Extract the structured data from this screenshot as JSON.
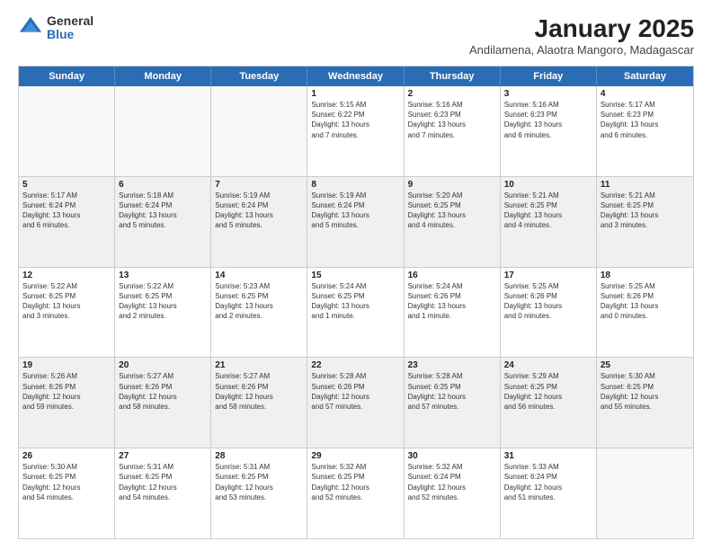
{
  "header": {
    "logo_general": "General",
    "logo_blue": "Blue",
    "title": "January 2025",
    "subtitle": "Andilamena, Alaotra Mangoro, Madagascar"
  },
  "days_of_week": [
    "Sunday",
    "Monday",
    "Tuesday",
    "Wednesday",
    "Thursday",
    "Friday",
    "Saturday"
  ],
  "weeks": [
    [
      {
        "num": "",
        "info": ""
      },
      {
        "num": "",
        "info": ""
      },
      {
        "num": "",
        "info": ""
      },
      {
        "num": "1",
        "info": "Sunrise: 5:15 AM\nSunset: 6:22 PM\nDaylight: 13 hours\nand 7 minutes."
      },
      {
        "num": "2",
        "info": "Sunrise: 5:16 AM\nSunset: 6:23 PM\nDaylight: 13 hours\nand 7 minutes."
      },
      {
        "num": "3",
        "info": "Sunrise: 5:16 AM\nSunset: 6:23 PM\nDaylight: 13 hours\nand 6 minutes."
      },
      {
        "num": "4",
        "info": "Sunrise: 5:17 AM\nSunset: 6:23 PM\nDaylight: 13 hours\nand 6 minutes."
      }
    ],
    [
      {
        "num": "5",
        "info": "Sunrise: 5:17 AM\nSunset: 6:24 PM\nDaylight: 13 hours\nand 6 minutes."
      },
      {
        "num": "6",
        "info": "Sunrise: 5:18 AM\nSunset: 6:24 PM\nDaylight: 13 hours\nand 5 minutes."
      },
      {
        "num": "7",
        "info": "Sunrise: 5:19 AM\nSunset: 6:24 PM\nDaylight: 13 hours\nand 5 minutes."
      },
      {
        "num": "8",
        "info": "Sunrise: 5:19 AM\nSunset: 6:24 PM\nDaylight: 13 hours\nand 5 minutes."
      },
      {
        "num": "9",
        "info": "Sunrise: 5:20 AM\nSunset: 6:25 PM\nDaylight: 13 hours\nand 4 minutes."
      },
      {
        "num": "10",
        "info": "Sunrise: 5:21 AM\nSunset: 6:25 PM\nDaylight: 13 hours\nand 4 minutes."
      },
      {
        "num": "11",
        "info": "Sunrise: 5:21 AM\nSunset: 6:25 PM\nDaylight: 13 hours\nand 3 minutes."
      }
    ],
    [
      {
        "num": "12",
        "info": "Sunrise: 5:22 AM\nSunset: 6:25 PM\nDaylight: 13 hours\nand 3 minutes."
      },
      {
        "num": "13",
        "info": "Sunrise: 5:22 AM\nSunset: 6:25 PM\nDaylight: 13 hours\nand 2 minutes."
      },
      {
        "num": "14",
        "info": "Sunrise: 5:23 AM\nSunset: 6:25 PM\nDaylight: 13 hours\nand 2 minutes."
      },
      {
        "num": "15",
        "info": "Sunrise: 5:24 AM\nSunset: 6:25 PM\nDaylight: 13 hours\nand 1 minute."
      },
      {
        "num": "16",
        "info": "Sunrise: 5:24 AM\nSunset: 6:26 PM\nDaylight: 13 hours\nand 1 minute."
      },
      {
        "num": "17",
        "info": "Sunrise: 5:25 AM\nSunset: 6:26 PM\nDaylight: 13 hours\nand 0 minutes."
      },
      {
        "num": "18",
        "info": "Sunrise: 5:25 AM\nSunset: 6:26 PM\nDaylight: 13 hours\nand 0 minutes."
      }
    ],
    [
      {
        "num": "19",
        "info": "Sunrise: 5:26 AM\nSunset: 6:26 PM\nDaylight: 12 hours\nand 59 minutes."
      },
      {
        "num": "20",
        "info": "Sunrise: 5:27 AM\nSunset: 6:26 PM\nDaylight: 12 hours\nand 58 minutes."
      },
      {
        "num": "21",
        "info": "Sunrise: 5:27 AM\nSunset: 6:26 PM\nDaylight: 12 hours\nand 58 minutes."
      },
      {
        "num": "22",
        "info": "Sunrise: 5:28 AM\nSunset: 6:26 PM\nDaylight: 12 hours\nand 57 minutes."
      },
      {
        "num": "23",
        "info": "Sunrise: 5:28 AM\nSunset: 6:25 PM\nDaylight: 12 hours\nand 57 minutes."
      },
      {
        "num": "24",
        "info": "Sunrise: 5:29 AM\nSunset: 6:25 PM\nDaylight: 12 hours\nand 56 minutes."
      },
      {
        "num": "25",
        "info": "Sunrise: 5:30 AM\nSunset: 6:25 PM\nDaylight: 12 hours\nand 55 minutes."
      }
    ],
    [
      {
        "num": "26",
        "info": "Sunrise: 5:30 AM\nSunset: 6:25 PM\nDaylight: 12 hours\nand 54 minutes."
      },
      {
        "num": "27",
        "info": "Sunrise: 5:31 AM\nSunset: 6:25 PM\nDaylight: 12 hours\nand 54 minutes."
      },
      {
        "num": "28",
        "info": "Sunrise: 5:31 AM\nSunset: 6:25 PM\nDaylight: 12 hours\nand 53 minutes."
      },
      {
        "num": "29",
        "info": "Sunrise: 5:32 AM\nSunset: 6:25 PM\nDaylight: 12 hours\nand 52 minutes."
      },
      {
        "num": "30",
        "info": "Sunrise: 5:32 AM\nSunset: 6:24 PM\nDaylight: 12 hours\nand 52 minutes."
      },
      {
        "num": "31",
        "info": "Sunrise: 5:33 AM\nSunset: 6:24 PM\nDaylight: 12 hours\nand 51 minutes."
      },
      {
        "num": "",
        "info": ""
      }
    ]
  ]
}
